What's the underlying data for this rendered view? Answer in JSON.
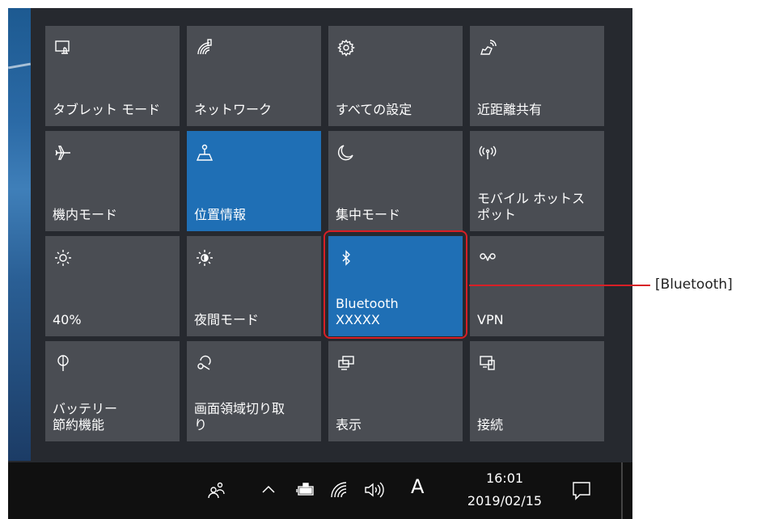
{
  "tiles": [
    {
      "label": "タブレット モード",
      "icon": "tablet-mode-icon",
      "active": false
    },
    {
      "label": "ネットワーク",
      "icon": "network-icon",
      "active": false
    },
    {
      "label": "すべての設定",
      "icon": "gear-icon",
      "active": false
    },
    {
      "label": "近距離共有",
      "icon": "nearby-share-icon",
      "active": false
    },
    {
      "label": "機内モード",
      "icon": "airplane-icon",
      "active": false
    },
    {
      "label": "位置情報",
      "icon": "location-icon",
      "active": true
    },
    {
      "label": "集中モード",
      "icon": "moon-icon",
      "active": false
    },
    {
      "label": "モバイル ホットス\nポット",
      "icon": "hotspot-icon",
      "active": false
    },
    {
      "label": "40%",
      "icon": "brightness-icon",
      "active": false
    },
    {
      "label": "夜間モード",
      "icon": "night-light-icon",
      "active": false
    },
    {
      "label": "Bluetooth\nXXXXX",
      "icon": "bluetooth-icon",
      "active": true
    },
    {
      "label": "VPN",
      "icon": "vpn-icon",
      "active": false
    },
    {
      "label": "バッテリー\n節約機能",
      "icon": "battery-saver-icon",
      "active": false
    },
    {
      "label": "画面領域切り取\nり",
      "icon": "snip-icon",
      "active": false
    },
    {
      "label": "表示",
      "icon": "project-icon",
      "active": false
    },
    {
      "label": "接続",
      "icon": "connect-icon",
      "active": false
    }
  ],
  "callout": {
    "label": "[Bluetooth]"
  },
  "taskbar": {
    "ime_mode": "A",
    "time": "16:01",
    "date": "2019/02/15"
  },
  "colors": {
    "tile": "#4a4d53",
    "tile_active": "#1f6fb5",
    "panel": "#26292f",
    "highlight": "#d81f26"
  }
}
